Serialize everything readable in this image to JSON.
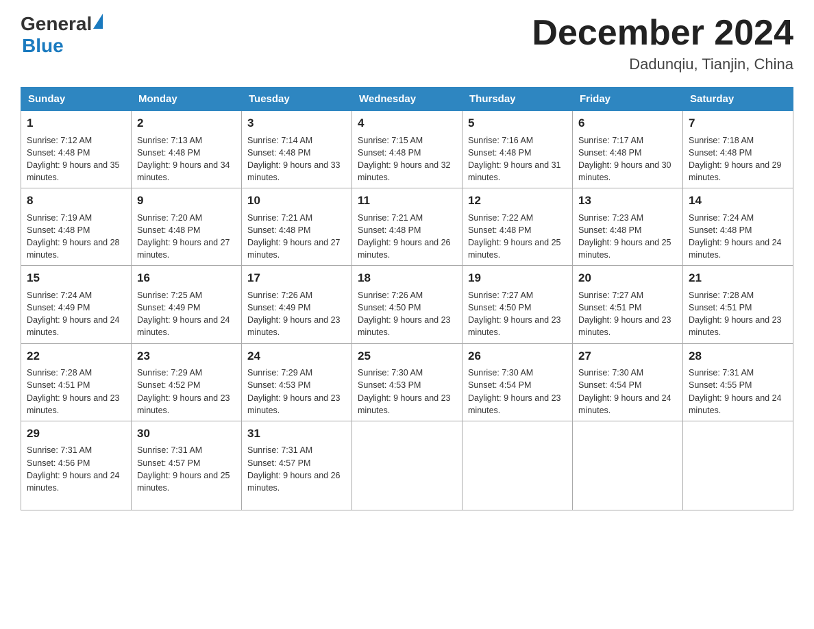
{
  "header": {
    "logo_general": "General",
    "logo_blue": "Blue",
    "month_title": "December 2024",
    "location": "Dadunqiu, Tianjin, China"
  },
  "days_of_week": [
    "Sunday",
    "Monday",
    "Tuesday",
    "Wednesday",
    "Thursday",
    "Friday",
    "Saturday"
  ],
  "weeks": [
    [
      {
        "day": "1",
        "sunrise": "7:12 AM",
        "sunset": "4:48 PM",
        "daylight": "9 hours and 35 minutes."
      },
      {
        "day": "2",
        "sunrise": "7:13 AM",
        "sunset": "4:48 PM",
        "daylight": "9 hours and 34 minutes."
      },
      {
        "day": "3",
        "sunrise": "7:14 AM",
        "sunset": "4:48 PM",
        "daylight": "9 hours and 33 minutes."
      },
      {
        "day": "4",
        "sunrise": "7:15 AM",
        "sunset": "4:48 PM",
        "daylight": "9 hours and 32 minutes."
      },
      {
        "day": "5",
        "sunrise": "7:16 AM",
        "sunset": "4:48 PM",
        "daylight": "9 hours and 31 minutes."
      },
      {
        "day": "6",
        "sunrise": "7:17 AM",
        "sunset": "4:48 PM",
        "daylight": "9 hours and 30 minutes."
      },
      {
        "day": "7",
        "sunrise": "7:18 AM",
        "sunset": "4:48 PM",
        "daylight": "9 hours and 29 minutes."
      }
    ],
    [
      {
        "day": "8",
        "sunrise": "7:19 AM",
        "sunset": "4:48 PM",
        "daylight": "9 hours and 28 minutes."
      },
      {
        "day": "9",
        "sunrise": "7:20 AM",
        "sunset": "4:48 PM",
        "daylight": "9 hours and 27 minutes."
      },
      {
        "day": "10",
        "sunrise": "7:21 AM",
        "sunset": "4:48 PM",
        "daylight": "9 hours and 27 minutes."
      },
      {
        "day": "11",
        "sunrise": "7:21 AM",
        "sunset": "4:48 PM",
        "daylight": "9 hours and 26 minutes."
      },
      {
        "day": "12",
        "sunrise": "7:22 AM",
        "sunset": "4:48 PM",
        "daylight": "9 hours and 25 minutes."
      },
      {
        "day": "13",
        "sunrise": "7:23 AM",
        "sunset": "4:48 PM",
        "daylight": "9 hours and 25 minutes."
      },
      {
        "day": "14",
        "sunrise": "7:24 AM",
        "sunset": "4:48 PM",
        "daylight": "9 hours and 24 minutes."
      }
    ],
    [
      {
        "day": "15",
        "sunrise": "7:24 AM",
        "sunset": "4:49 PM",
        "daylight": "9 hours and 24 minutes."
      },
      {
        "day": "16",
        "sunrise": "7:25 AM",
        "sunset": "4:49 PM",
        "daylight": "9 hours and 24 minutes."
      },
      {
        "day": "17",
        "sunrise": "7:26 AM",
        "sunset": "4:49 PM",
        "daylight": "9 hours and 23 minutes."
      },
      {
        "day": "18",
        "sunrise": "7:26 AM",
        "sunset": "4:50 PM",
        "daylight": "9 hours and 23 minutes."
      },
      {
        "day": "19",
        "sunrise": "7:27 AM",
        "sunset": "4:50 PM",
        "daylight": "9 hours and 23 minutes."
      },
      {
        "day": "20",
        "sunrise": "7:27 AM",
        "sunset": "4:51 PM",
        "daylight": "9 hours and 23 minutes."
      },
      {
        "day": "21",
        "sunrise": "7:28 AM",
        "sunset": "4:51 PM",
        "daylight": "9 hours and 23 minutes."
      }
    ],
    [
      {
        "day": "22",
        "sunrise": "7:28 AM",
        "sunset": "4:51 PM",
        "daylight": "9 hours and 23 minutes."
      },
      {
        "day": "23",
        "sunrise": "7:29 AM",
        "sunset": "4:52 PM",
        "daylight": "9 hours and 23 minutes."
      },
      {
        "day": "24",
        "sunrise": "7:29 AM",
        "sunset": "4:53 PM",
        "daylight": "9 hours and 23 minutes."
      },
      {
        "day": "25",
        "sunrise": "7:30 AM",
        "sunset": "4:53 PM",
        "daylight": "9 hours and 23 minutes."
      },
      {
        "day": "26",
        "sunrise": "7:30 AM",
        "sunset": "4:54 PM",
        "daylight": "9 hours and 23 minutes."
      },
      {
        "day": "27",
        "sunrise": "7:30 AM",
        "sunset": "4:54 PM",
        "daylight": "9 hours and 24 minutes."
      },
      {
        "day": "28",
        "sunrise": "7:31 AM",
        "sunset": "4:55 PM",
        "daylight": "9 hours and 24 minutes."
      }
    ],
    [
      {
        "day": "29",
        "sunrise": "7:31 AM",
        "sunset": "4:56 PM",
        "daylight": "9 hours and 24 minutes."
      },
      {
        "day": "30",
        "sunrise": "7:31 AM",
        "sunset": "4:57 PM",
        "daylight": "9 hours and 25 minutes."
      },
      {
        "day": "31",
        "sunrise": "7:31 AM",
        "sunset": "4:57 PM",
        "daylight": "9 hours and 26 minutes."
      },
      null,
      null,
      null,
      null
    ]
  ],
  "labels": {
    "sunrise": "Sunrise:",
    "sunset": "Sunset:",
    "daylight": "Daylight:"
  }
}
